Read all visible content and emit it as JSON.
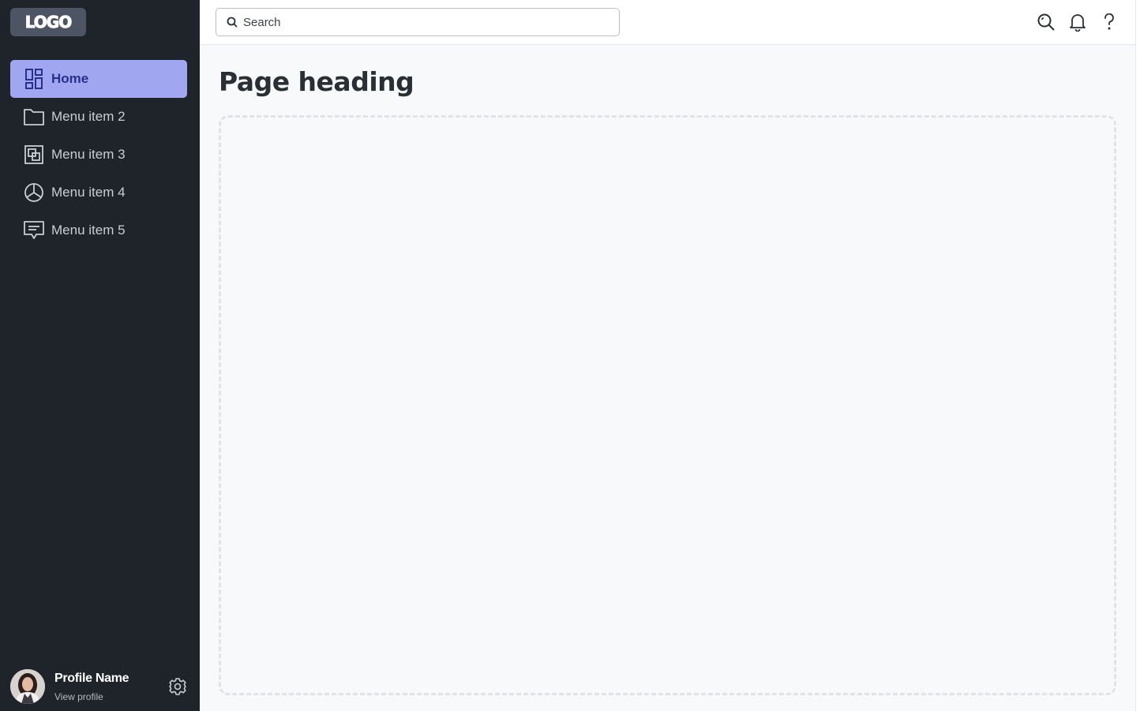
{
  "logo": {
    "text": "LOGO"
  },
  "sidebar": {
    "items": [
      {
        "label": "Home",
        "icon": "dashboard-icon",
        "active": true
      },
      {
        "label": "Menu item 2",
        "icon": "folder-icon",
        "active": false
      },
      {
        "label": "Menu item 3",
        "icon": "layers-icon",
        "active": false
      },
      {
        "label": "Menu item 4",
        "icon": "pie-chart-icon",
        "active": false
      },
      {
        "label": "Menu item 5",
        "icon": "message-icon",
        "active": false
      }
    ]
  },
  "profile": {
    "name": "Profile Name",
    "link": "View profile",
    "settings_icon": "gear-icon"
  },
  "search": {
    "placeholder": "Search",
    "value": ""
  },
  "topbar": {
    "icons": [
      "search-icon",
      "bell-icon",
      "help-icon"
    ]
  },
  "main": {
    "heading": "Page heading"
  },
  "colors": {
    "sidebar_bg": "#1f242b",
    "active_bg": "#a1a6f0",
    "active_text": "#2b2f8c",
    "page_bg": "#f8f9fa"
  }
}
